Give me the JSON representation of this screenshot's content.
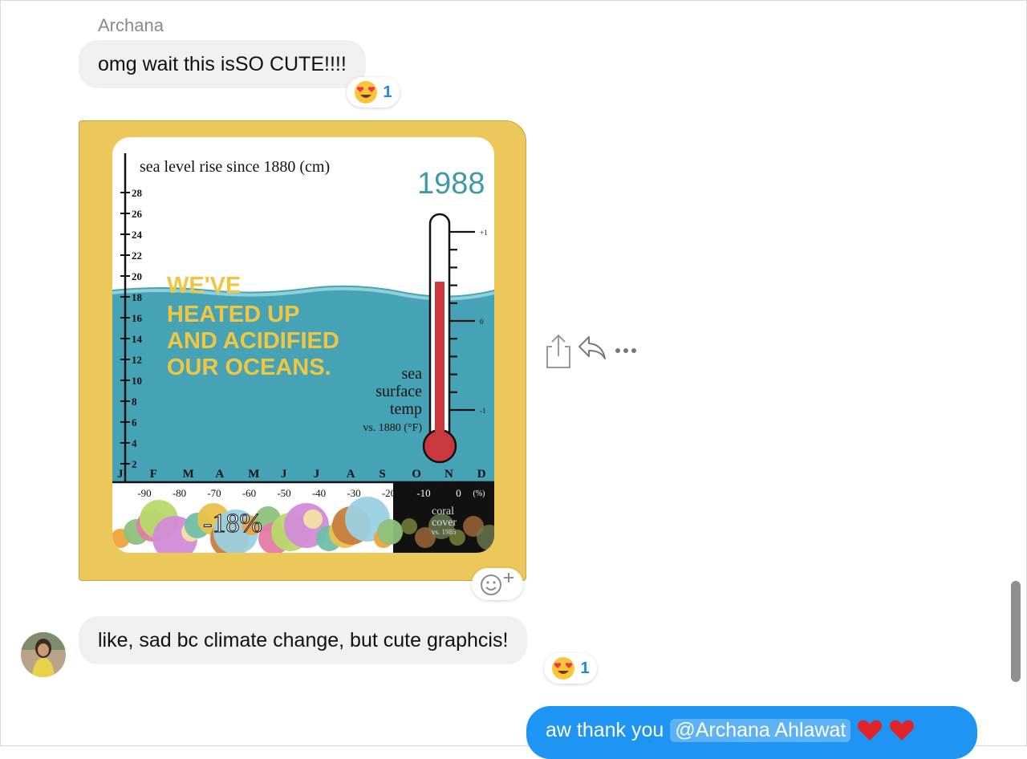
{
  "sender_name": "Archana",
  "messages": {
    "m1": {
      "text": "omg wait this isSO CUTE!!!!",
      "reaction_count": "1",
      "reaction_emoji": "heart-eyes"
    },
    "m2": {
      "image": {
        "title": "sea level rise since 1880 (cm)",
        "year": "1988",
        "y_ticks": [
          "28",
          "26",
          "24",
          "22",
          "20",
          "18",
          "16",
          "14",
          "12",
          "10",
          "8",
          "6",
          "4",
          "2"
        ],
        "months": [
          "J",
          "F",
          "M",
          "A",
          "M",
          "J",
          "J",
          "A",
          "S",
          "O",
          "N",
          "D"
        ],
        "bottom_ticks": [
          "-90",
          "-80",
          "-70",
          "-60",
          "-50",
          "-40",
          "-30",
          "-20",
          "-10",
          "0"
        ],
        "bottom_unit": "(%)",
        "headline": [
          "WE'VE",
          "HEATED UP",
          "AND ACIDIFIED",
          "OUR OCEANS."
        ],
        "temp_label": [
          "sea",
          "surface",
          "temp",
          "vs. 1880 (°F)"
        ],
        "temp_ticks": [
          "+1",
          "0",
          "-1"
        ],
        "thermometer_level": 0.72,
        "coral_percent": "-18%",
        "coral_label": [
          "coral",
          "cover",
          "vs. 1985"
        ]
      }
    },
    "m3": {
      "text": "like, sad bc climate change, but cute graphcis!",
      "reaction_count": "1",
      "reaction_emoji": "heart-eyes"
    },
    "m4": {
      "prefix": "aw thank you",
      "mention": "@Archana Ahlawat",
      "emoji": "hearts"
    }
  },
  "colors": {
    "outgoing_bubble": "#1e95f2",
    "incoming_bubble": "#f0f0f0",
    "reaction_count": "#1e88e5",
    "card_border": "#ecc85a"
  }
}
